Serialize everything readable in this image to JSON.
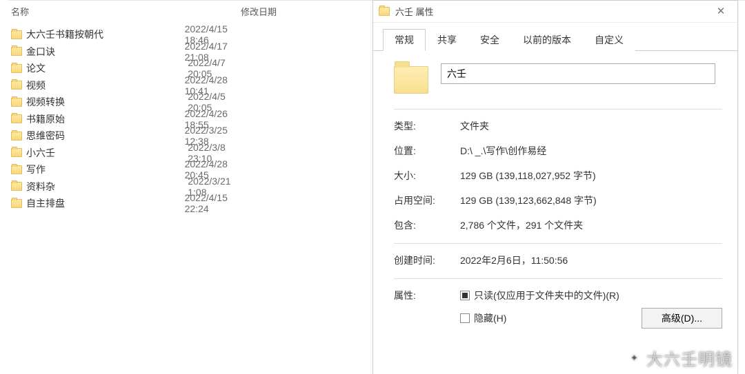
{
  "explorer": {
    "columns": {
      "name": "名称",
      "date": "修改日期"
    },
    "items": [
      {
        "name": "大六壬书籍按朝代",
        "date": "2022/4/15 18:46"
      },
      {
        "name": "金口诀",
        "date": "2022/4/17 21:08"
      },
      {
        "name": "论文",
        "date": "2022/4/7 20:05"
      },
      {
        "name": "视频",
        "date": "2022/4/28 10:41"
      },
      {
        "name": "视频转换",
        "date": "2022/4/5 20:05"
      },
      {
        "name": "书籍原始",
        "date": "2022/4/26 18:55"
      },
      {
        "name": "思维密码",
        "date": "2022/3/25 12:38"
      },
      {
        "name": "小六壬",
        "date": "2022/3/8 23:10"
      },
      {
        "name": "写作",
        "date": "2022/4/28 20:45"
      },
      {
        "name": "资料杂",
        "date": "2022/3/21 1:08"
      },
      {
        "name": "自主排盘",
        "date": "2022/4/15 22:24"
      }
    ]
  },
  "dialog": {
    "title": "六壬 属性",
    "tabs": [
      "常规",
      "共享",
      "安全",
      "以前的版本",
      "自定义"
    ],
    "folder_name": "六壬",
    "labels": {
      "type": "类型:",
      "location": "位置:",
      "size": "大小:",
      "size_on_disk": "占用空间:",
      "contains": "包含:",
      "created": "创建时间:",
      "attributes": "属性:"
    },
    "values": {
      "type": "文件夹",
      "location": "D:\\            _.\\写作\\创作易经",
      "size": "129 GB (139,118,027,952 字节)",
      "size_on_disk": "129 GB (139,123,662,848 字节)",
      "contains": "2,786 个文件，291 个文件夹",
      "created": "2022年2月6日，11:50:56"
    },
    "attributes": {
      "readonly_label": "只读(仅应用于文件夹中的文件)(R)",
      "hidden_label": "隐藏(H)",
      "advanced_btn": "高级(D)..."
    }
  },
  "watermark": "大六壬明镜"
}
